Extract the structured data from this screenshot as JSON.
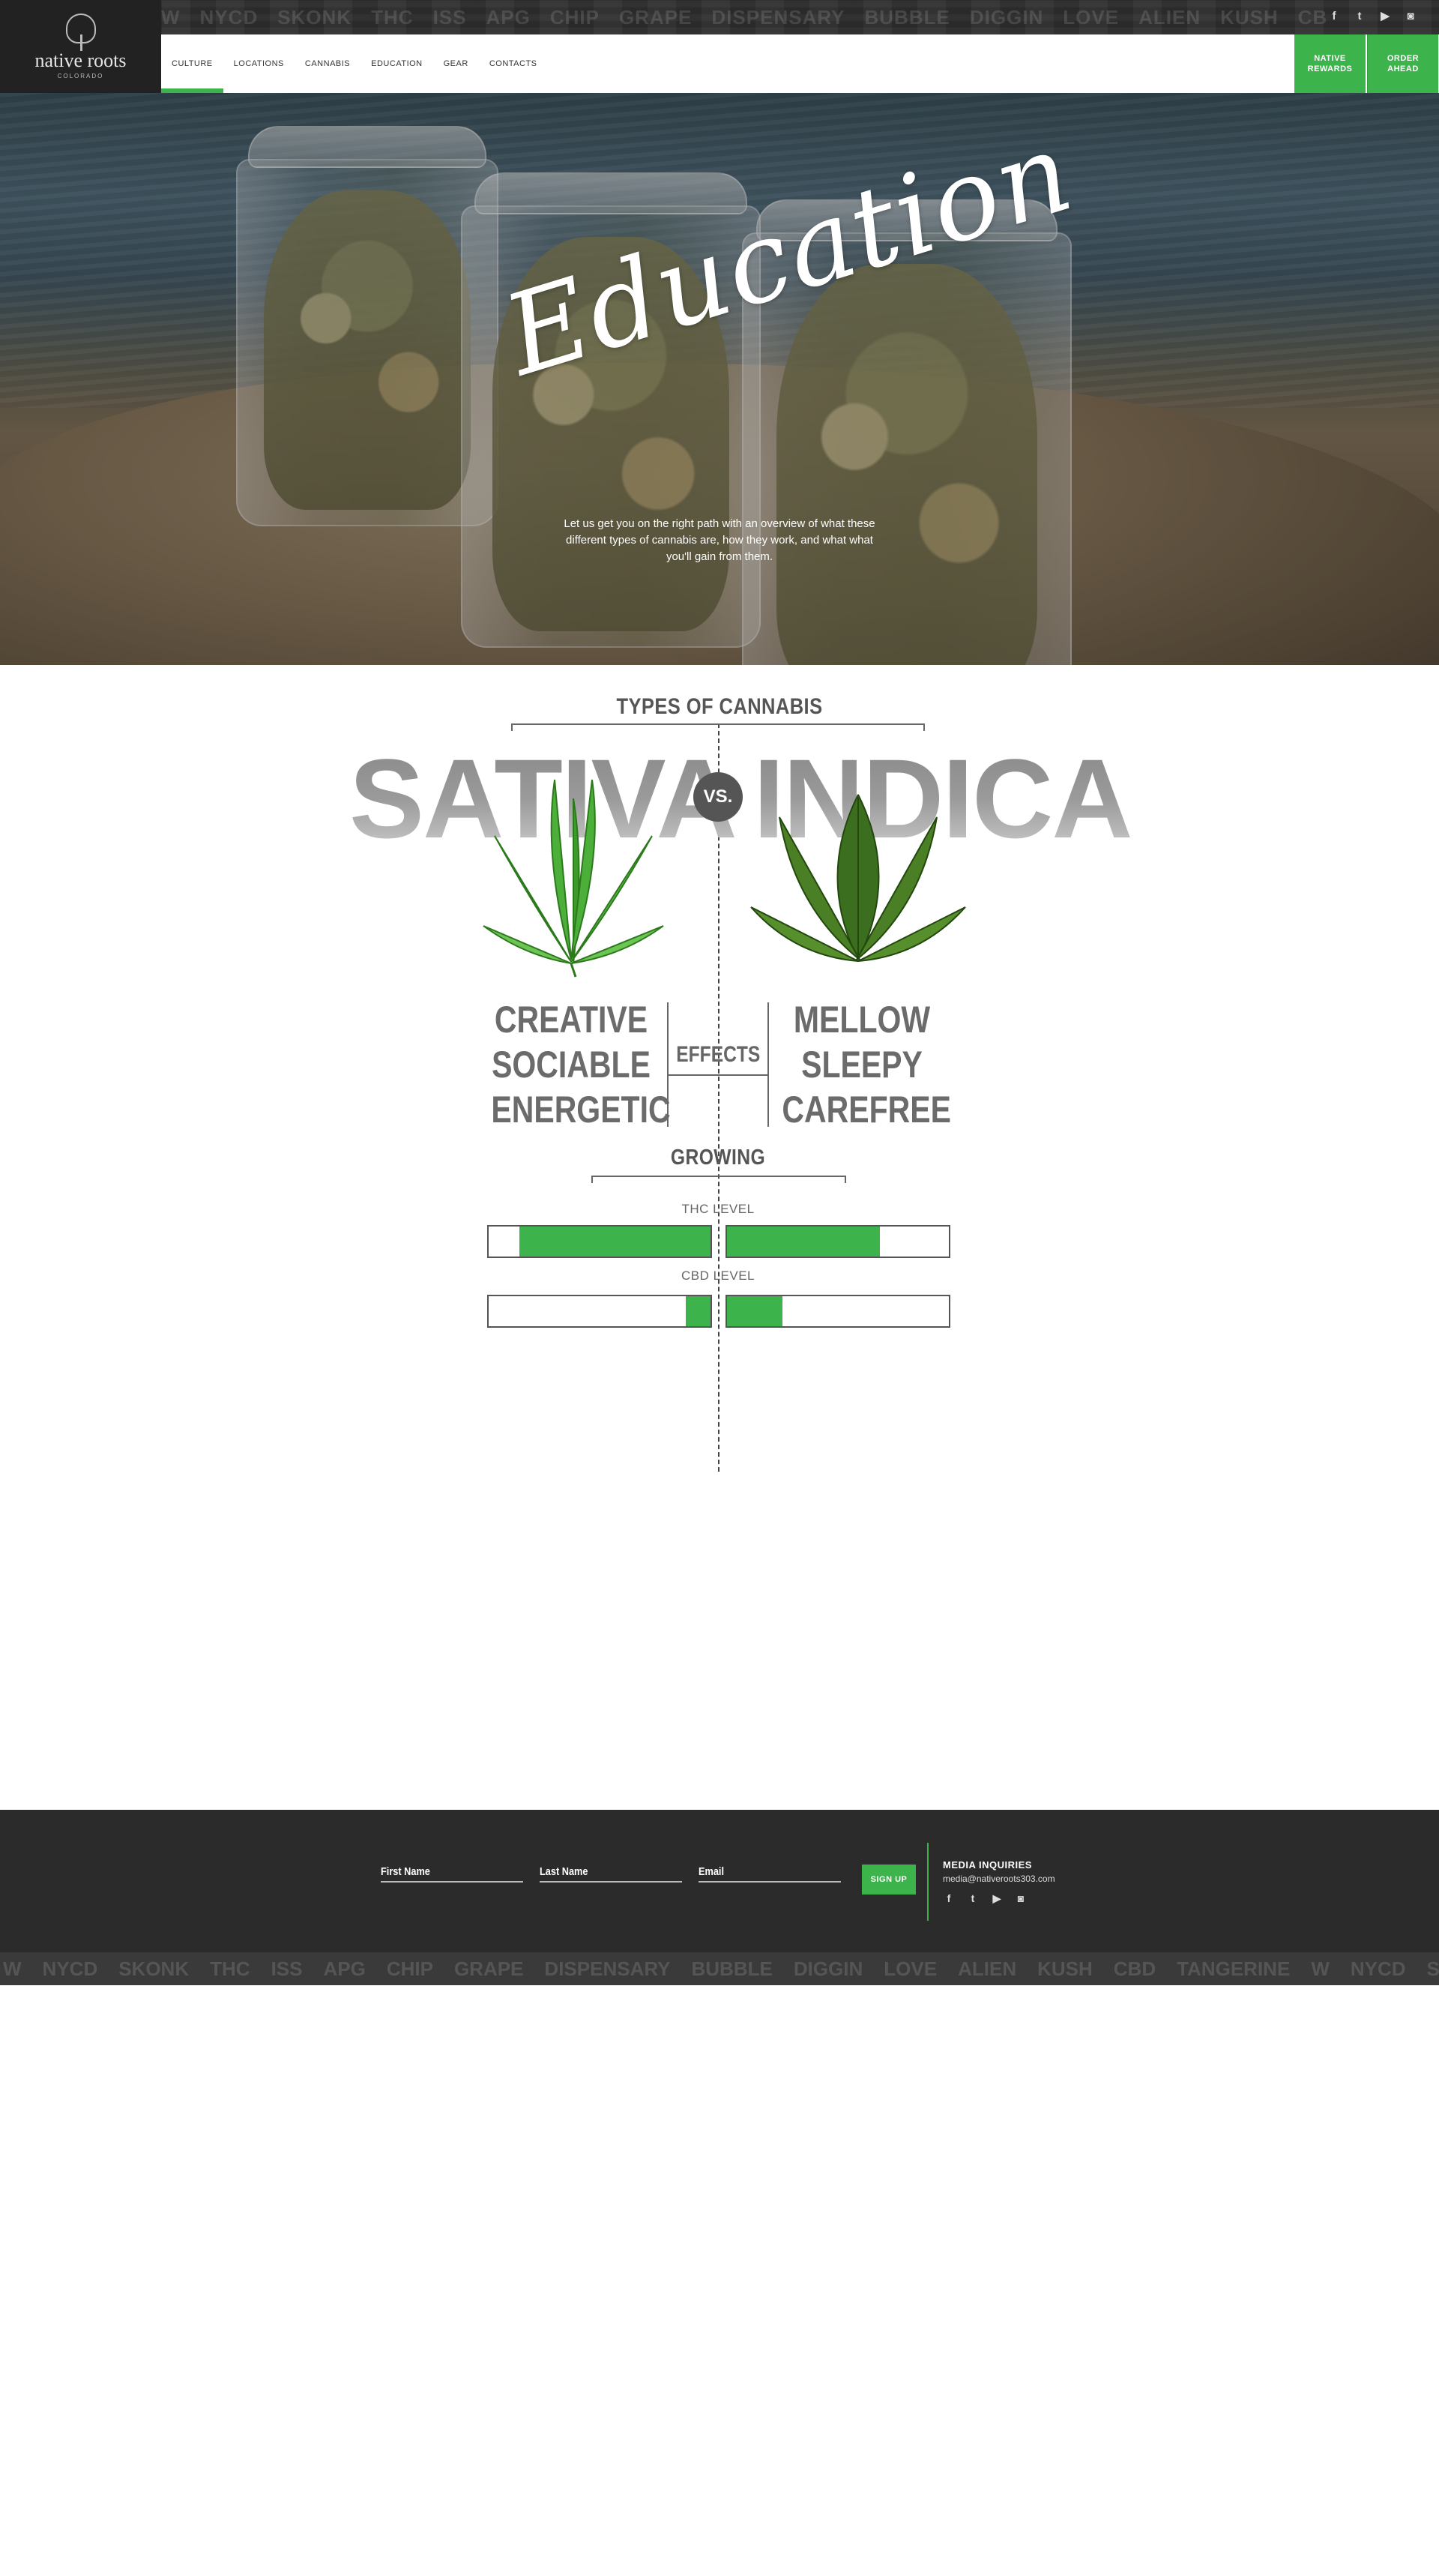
{
  "header": {
    "logo": {
      "name": "native roots",
      "sub": "COLORADO"
    },
    "pattern_words": [
      "W",
      "NYCD",
      "SKONK",
      "THC",
      "ISS",
      "APG",
      "CHIP",
      "GRAPE",
      "DISPENSARY",
      "BUBBLE",
      "DIGGIN",
      "LOVE",
      "ALIEN",
      "KUSH",
      "CBD",
      "TANGERINE"
    ],
    "social": [
      {
        "icon": "facebook-icon",
        "glyph": "f"
      },
      {
        "icon": "twitter-icon",
        "glyph": "t"
      },
      {
        "icon": "youtube-icon",
        "glyph": "▶"
      },
      {
        "icon": "instagram-icon",
        "glyph": "◙"
      }
    ],
    "nav": [
      {
        "label": "CULTURE",
        "active": true
      },
      {
        "label": "LOCATIONS",
        "active": false
      },
      {
        "label": "CANNABIS",
        "active": false
      },
      {
        "label": "EDUCATION",
        "active": false
      },
      {
        "label": "GEAR",
        "active": false
      },
      {
        "label": "CONTACTS",
        "active": false
      }
    ],
    "cta_rewards": "NATIVE\nREWARDS",
    "cta_order": "ORDER\nAHEAD"
  },
  "hero": {
    "title": "Education",
    "text": "Let us get you on the right path with an overview of what these different types of cannabis are, how they work, and what what you'll gain from them."
  },
  "comparison": {
    "heading": "TYPES OF CANNABIS",
    "left_type": "SATIVA",
    "vs": "VS.",
    "right_type": "INDICA",
    "effects_label": "EFFECTS",
    "sativa_effects": [
      "CREATIVE",
      "SOCIABLE",
      "ENERGETIC"
    ],
    "indica_effects": [
      "MELLOW",
      "SLEEPY",
      "CAREFREE"
    ],
    "growing_heading": "GROWING",
    "thc_label": "THC LEVEL",
    "cbd_label": "CBD LEVEL",
    "levels": {
      "sativa_thc": 0.86,
      "indica_thc": 0.69,
      "sativa_cbd": 0.11,
      "indica_cbd": 0.25
    }
  },
  "footer": {
    "first_name_placeholder": "First Name",
    "last_name_placeholder": "Last Name",
    "email_placeholder": "Email",
    "signup_label": "SIGN UP",
    "media_heading": "MEDIA INQUIRIES",
    "media_email": "media@nativeroots303.com"
  },
  "colors": {
    "accent": "#3cb44b",
    "dark": "#2b2b2b"
  }
}
